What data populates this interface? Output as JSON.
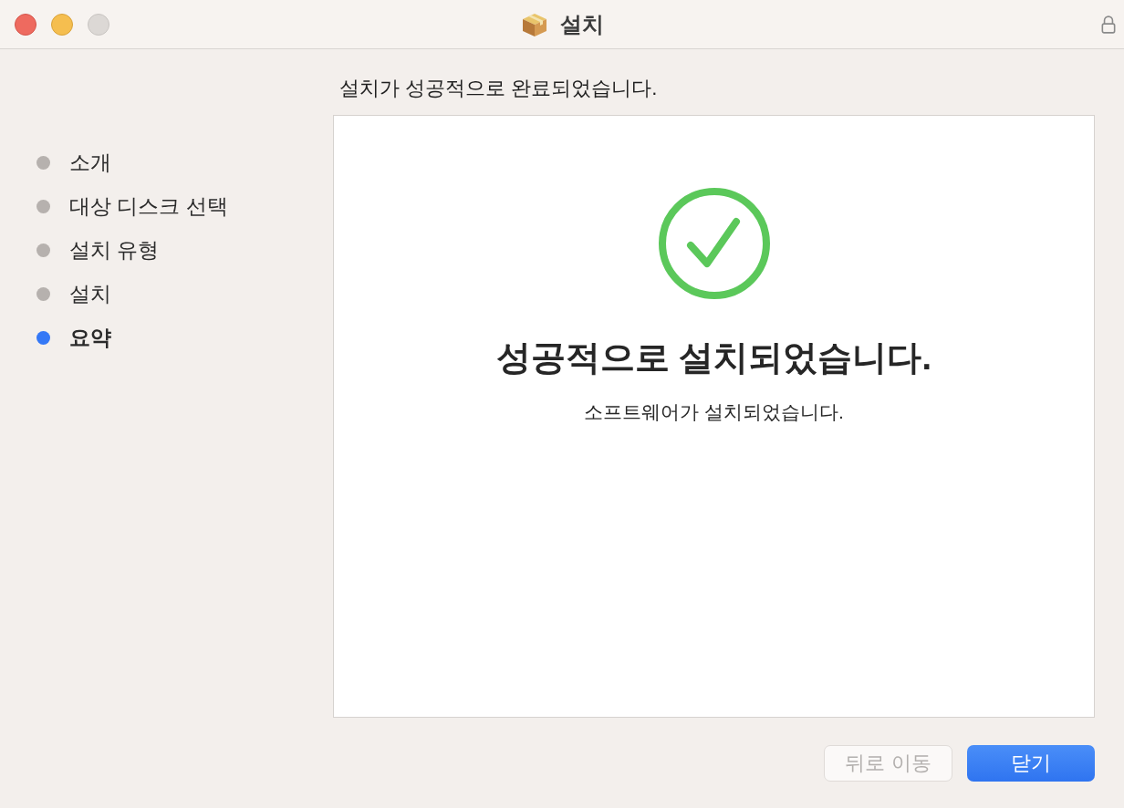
{
  "window": {
    "title": "설치"
  },
  "steps": [
    {
      "label": "소개",
      "selected": false
    },
    {
      "label": "대상 디스크 선택",
      "selected": false
    },
    {
      "label": "설치 유형",
      "selected": false
    },
    {
      "label": "설치",
      "selected": false
    },
    {
      "label": "요약",
      "selected": true
    }
  ],
  "heading": "설치가 성공적으로 완료되었습니다.",
  "result": {
    "title": "성공적으로 설치되었습니다.",
    "message": "소프트웨어가 설치되었습니다."
  },
  "buttons": [
    {
      "label": "뒤로 이동",
      "kind": "secondary",
      "disabled": true
    },
    {
      "label": "닫기",
      "kind": "primary",
      "disabled": false
    }
  ]
}
